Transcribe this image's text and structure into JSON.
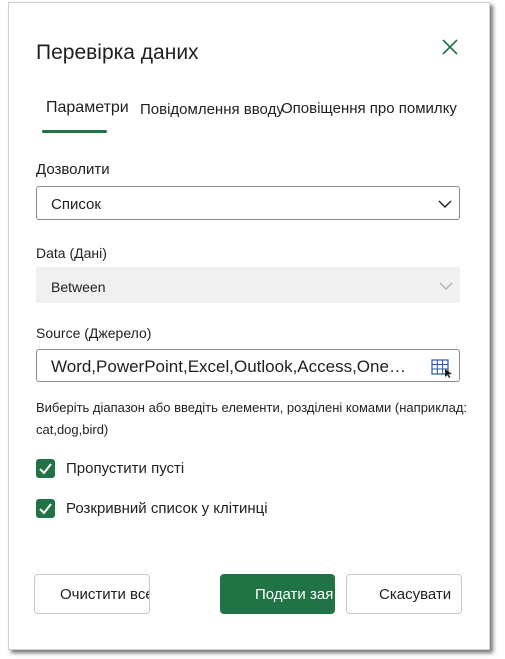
{
  "dialog": {
    "title": "Перевірка даних",
    "close_icon": "close-icon"
  },
  "tabs": [
    {
      "label": "Параметри",
      "active": true
    },
    {
      "label": "Повідомлення вводу",
      "active": false
    },
    {
      "label": "Оповіщення про помилку",
      "active": false
    }
  ],
  "allow": {
    "label": "Дозволити",
    "value": "Список"
  },
  "data_field": {
    "label": "Data (Дані)",
    "value": "Between",
    "disabled": true
  },
  "source": {
    "label": "Source (Джерело)",
    "value": "Word,PowerPoint,Excel,Outlook,Access,OneN...",
    "range_icon": "range-select-icon"
  },
  "hint": "Виберіть діапазон або введіть елементи, розділені комами (наприклад: cat,dog,bird)",
  "checkboxes": [
    {
      "label": "Пропустити пусті",
      "checked": true
    },
    {
      "label": "Розкривний список у клітинці",
      "checked": true
    }
  ],
  "buttons": {
    "clear": "Очистити все",
    "submit": "Подати зая",
    "cancel": "Скасувати"
  },
  "colors": {
    "accent": "#217346",
    "border": "#8a8a8a",
    "disabled_bg": "#f0f0f0"
  }
}
